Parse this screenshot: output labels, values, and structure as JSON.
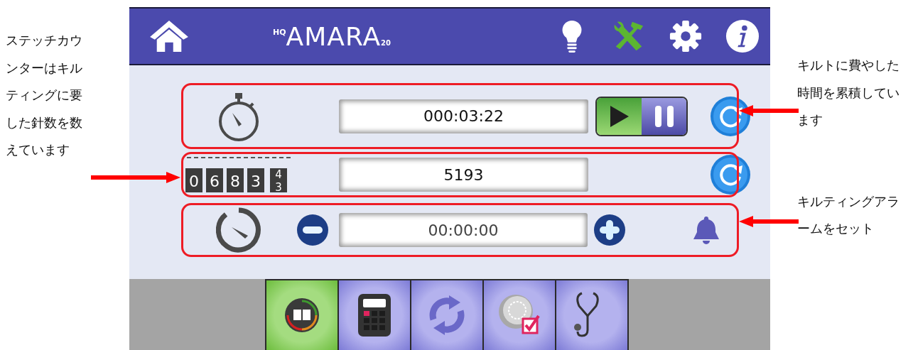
{
  "annotations_left": [
    {
      "text": "ステッチカウンターはキルティングに要した針数を数えています"
    }
  ],
  "annotations_right": [
    {
      "text": "キルトに費やした時間を累積しています"
    },
    {
      "text": "キルティングアラームをセット"
    }
  ],
  "header": {
    "logo": {
      "prefix": "HQ",
      "name": "AMARA",
      "suffix": "20"
    },
    "buttons": [
      {
        "kind": "home",
        "selected": false
      },
      {
        "kind": "bulb",
        "selected": false
      },
      {
        "kind": "tools",
        "selected": true
      },
      {
        "kind": "gear",
        "selected": false
      },
      {
        "kind": "info",
        "selected": false
      }
    ]
  },
  "rows": [
    {
      "kind": "timer",
      "value": "000:03:22",
      "playing": true
    },
    {
      "kind": "counter",
      "digits": [
        "0",
        "6",
        "8",
        "3"
      ],
      "rolling": [
        "4",
        "3"
      ],
      "value": "5193"
    },
    {
      "kind": "alarm",
      "value": "00:00:00"
    }
  ],
  "tabs": [
    {
      "kind": "counter",
      "selected": true
    },
    {
      "kind": "calculator",
      "selected": false
    },
    {
      "kind": "sync",
      "selected": false
    },
    {
      "kind": "dial",
      "selected": false
    },
    {
      "kind": "stethoscope",
      "selected": false
    }
  ]
}
